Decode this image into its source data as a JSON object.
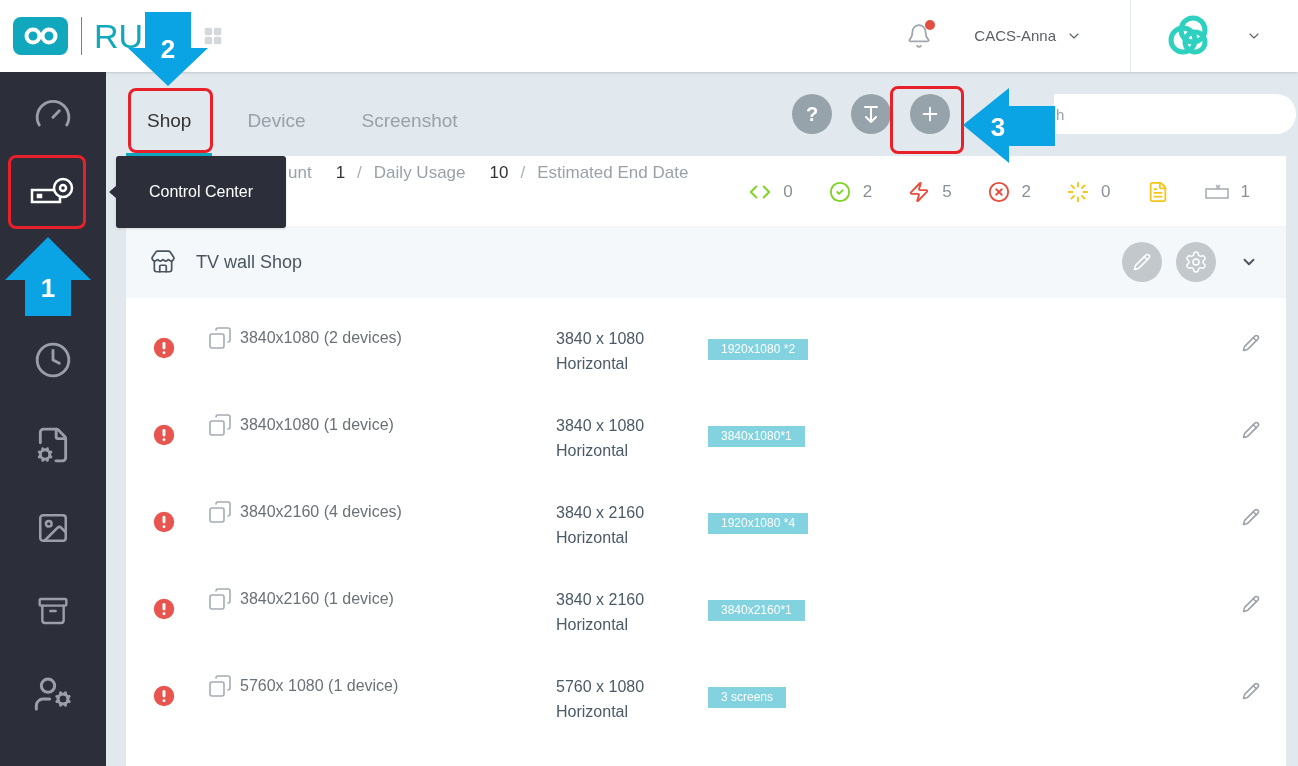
{
  "header": {
    "logo_text": "RU",
    "user": "CACS-Anna",
    "notification": true
  },
  "sidebar": {
    "items": [
      {
        "kind": "dashboard"
      },
      {
        "kind": "control"
      },
      {
        "kind": "schedule"
      },
      {
        "kind": "report"
      },
      {
        "kind": "media"
      },
      {
        "kind": "archive"
      },
      {
        "kind": "users"
      }
    ],
    "tooltip": "Control Center"
  },
  "tabs": [
    {
      "label": "Shop",
      "selected": true
    },
    {
      "label": "Device",
      "selected": false
    },
    {
      "label": "Screenshot",
      "selected": false
    }
  ],
  "search": {
    "placeholder": "h"
  },
  "summary": [
    {
      "label": "unt",
      "value": "1"
    },
    {
      "separator": "/",
      "label": "Daily Usage",
      "value": "10"
    },
    {
      "separator": "/",
      "label": "Estimated End Date"
    }
  ],
  "help_label": "?",
  "status": [
    {
      "kind": "code",
      "count": "0"
    },
    {
      "kind": "synced",
      "count": "2"
    },
    {
      "kind": "error",
      "count": "5"
    },
    {
      "kind": "failed",
      "count": "2"
    },
    {
      "kind": "loading",
      "count": "0"
    },
    {
      "kind": "document"
    },
    {
      "kind": "offline",
      "count": "1"
    }
  ],
  "group": {
    "title": "TV wall Shop"
  },
  "rows": [
    {
      "name": "3840x1080 (2 devices)",
      "resolution": "3840 x 1080",
      "orientation": "Horizontal",
      "tag": "1920x1080 *2"
    },
    {
      "name": "3840x1080 (1 device)",
      "resolution": "3840 x 1080",
      "orientation": "Horizontal",
      "tag": "3840x1080*1"
    },
    {
      "name": "3840x2160 (4 devices)",
      "resolution": "3840 x 2160",
      "orientation": "Horizontal",
      "tag": "1920x1080 *4"
    },
    {
      "name": "3840x2160 (1 device)",
      "resolution": "3840 x 2160",
      "orientation": "Horizontal",
      "tag": "3840x2160*1"
    },
    {
      "name": "5760x 1080 (1 device)",
      "resolution": "5760 x 1080",
      "orientation": "Horizontal",
      "tag": "3 screens"
    }
  ],
  "annotations": [
    {
      "number": "1"
    },
    {
      "number": "2"
    },
    {
      "number": "3"
    }
  ]
}
